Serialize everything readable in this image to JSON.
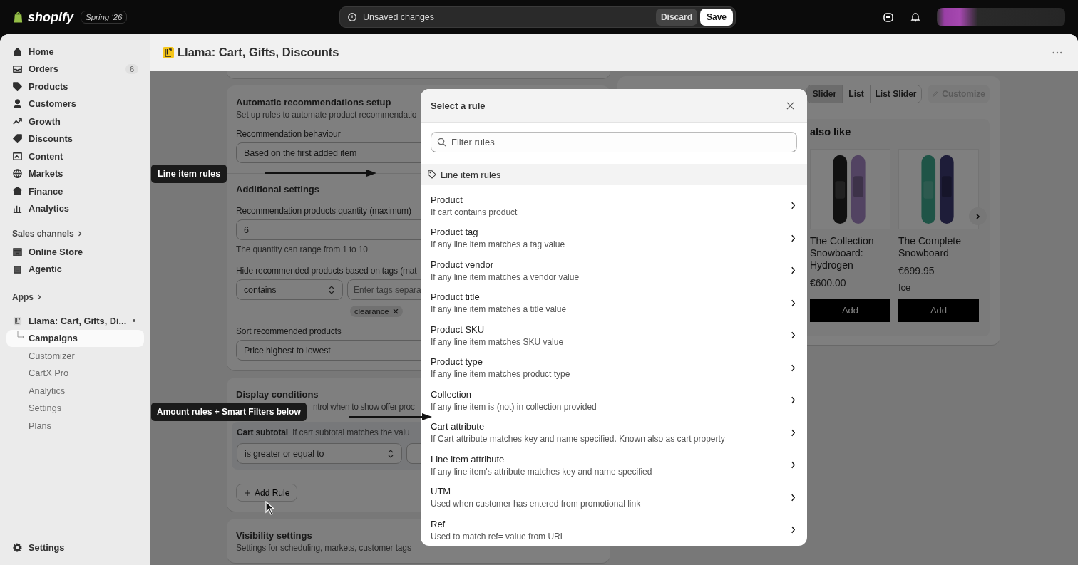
{
  "topbar": {
    "brand": "shopify",
    "badge": "Spring '26",
    "unsaved": {
      "message": "Unsaved changes",
      "discard": "Discard",
      "save": "Save"
    }
  },
  "sidebar": {
    "items": [
      {
        "label": "Home",
        "selected": false
      },
      {
        "label": "Orders",
        "badge": "6",
        "selected": false
      },
      {
        "label": "Products",
        "selected": false
      },
      {
        "label": "Customers",
        "selected": false
      },
      {
        "label": "Growth",
        "selected": false
      },
      {
        "label": "Discounts",
        "selected": false
      },
      {
        "label": "Content",
        "selected": false
      },
      {
        "label": "Markets",
        "selected": false
      },
      {
        "label": "Finance",
        "selected": false
      },
      {
        "label": "Analytics",
        "selected": false
      }
    ],
    "sales_channels": {
      "title": "Sales channels",
      "items": [
        {
          "label": "Online Store"
        },
        {
          "label": "Agentic"
        }
      ]
    },
    "apps": {
      "title": "Apps",
      "app": {
        "label": "Llama: Cart, Gifts, Di...",
        "children": [
          {
            "label": "Campaigns",
            "selected": true
          },
          {
            "label": "Customizer",
            "selected": false
          },
          {
            "label": "CartX Pro",
            "selected": false
          },
          {
            "label": "Analytics",
            "selected": false
          },
          {
            "label": "Settings",
            "selected": false
          },
          {
            "label": "Plans",
            "selected": false
          }
        ]
      }
    },
    "settings": "Settings"
  },
  "page": {
    "title": "Llama: Cart, Gifts, Discounts"
  },
  "recommendations": {
    "title": "Automatic recommendations setup",
    "subtitle": "Set up rules to automate product recommendatio",
    "behaviour_label": "Recommendation behaviour",
    "behaviour_value": "Based on the first added item",
    "additional_title": "Additional settings",
    "quantity_label": "Recommendation products quantity (maximum)",
    "quantity_value": "6",
    "quantity_help": "The quantity can range from 1 to 10",
    "hide_label": "Hide recommended products based on tags (mat",
    "hide_operator": "contains",
    "hide_placeholder": "Enter tags separa",
    "tags": [
      "clearance"
    ],
    "sort_label": "Sort recommended products",
    "sort_value": "Price highest to lowest"
  },
  "display_conditions": {
    "title": "Display conditions",
    "subtitle": "ntrol when to show offer proc",
    "rule_name": "Cart subtotal",
    "rule_desc": "If cart subtotal matches the valu",
    "rule_operator": "is greater or equal to",
    "add_rule": "Add Rule"
  },
  "visibility": {
    "title": "Visibility settings",
    "subtitle": "Settings for scheduling, markets, customer tags"
  },
  "preview": {
    "layouts": [
      {
        "label": "Slider",
        "selected": true
      },
      {
        "label": "List",
        "selected": false
      },
      {
        "label": "List Slider",
        "selected": false
      }
    ],
    "customize": {
      "label": "Customize",
      "disabled": true
    },
    "heading": "also like",
    "products": [
      {
        "name": "The Collection Snowboard: Hydrogen",
        "price": "€600.00",
        "button": "Add"
      },
      {
        "name": "The Complete Snowboard",
        "price": "€699.95",
        "variant": "Ice",
        "button": "Add"
      }
    ]
  },
  "annotations": [
    {
      "text": "Line item rules"
    },
    {
      "text": "Amount rules + Smart Filters below"
    }
  ],
  "modal": {
    "title": "Select a rule",
    "search_placeholder": "Filter rules",
    "section": "Line item rules",
    "rules": [
      {
        "title": "Product",
        "description": "If cart contains product"
      },
      {
        "title": "Product tag",
        "description": "If any line item matches a tag value"
      },
      {
        "title": "Product vendor",
        "description": "If any line item matches a vendor value"
      },
      {
        "title": "Product title",
        "description": "If any line item matches a title value"
      },
      {
        "title": "Product SKU",
        "description": "If any line item matches SKU value"
      },
      {
        "title": "Product type",
        "description": "If any line item matches product type"
      },
      {
        "title": "Collection",
        "description": "If any line item is (not) in collection provided"
      },
      {
        "title": "Cart attribute",
        "description": "If Cart attribute matches key and name specified. Known also as cart property"
      },
      {
        "title": "Line item attribute",
        "description": "If any line item's attribute matches key and name specified"
      },
      {
        "title": "UTM",
        "description": "Used when customer has entered from promotional link"
      },
      {
        "title": "Ref",
        "description": "Used to match ref= value from URL"
      }
    ]
  }
}
